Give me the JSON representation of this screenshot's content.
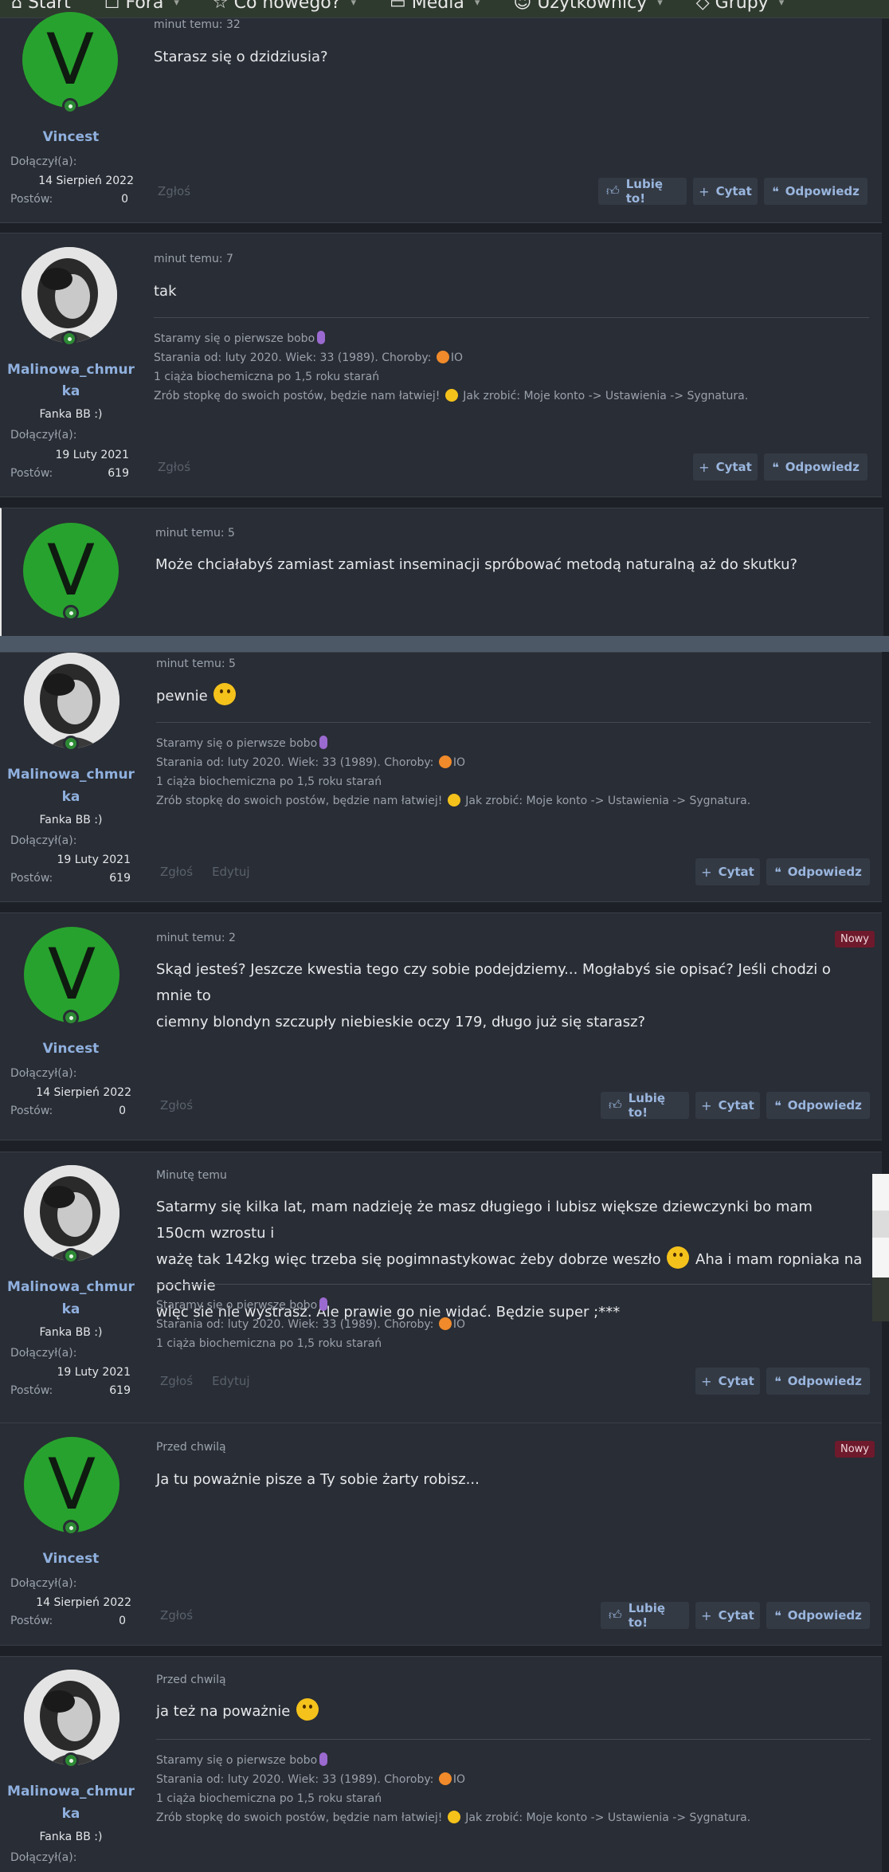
{
  "nav": {
    "items": [
      {
        "label": "Start",
        "icon": "home-icon"
      },
      {
        "label": "Fora",
        "icon": "chat-icon"
      },
      {
        "label": "Co nowego?",
        "icon": "bookmark-icon"
      },
      {
        "label": "Media",
        "icon": "media-icon"
      },
      {
        "label": "Użytkownicy",
        "icon": "user-icon"
      },
      {
        "label": "Grupy",
        "icon": "diamond-icon"
      }
    ]
  },
  "labels": {
    "joined": "Dołączył(a):",
    "posts": "Postów:",
    "report": "Zgłoś",
    "edit": "Edytuj",
    "like": "Lubię to!",
    "quote": "Cytat",
    "reply": "Odpowiedz",
    "new": "Nowy"
  },
  "users": {
    "vincest": {
      "name": "Vincest",
      "initial": "V",
      "joined": "14 Sierpień 2022",
      "posts": "0"
    },
    "malinowa": {
      "name_line1": "Malinowa_chmur",
      "name_line2": "ka",
      "title": "Fanka BB :)",
      "joined": "19 Luty 2021",
      "posts": "619"
    }
  },
  "signature": {
    "line1": "Staramy się o pierwsze bobo",
    "line2a": "Starania od: luty 2020. Wiek: 33 (1989). Choroby:",
    "line2b": "IO",
    "line3": "1 ciąża biochemiczna po 1,5 roku starań",
    "line4a": "Zrób stopkę do swoich postów, będzie nam łatwiej!",
    "line4b": "Jak zrobić: Moje konto -> Ustawienia -> Sygnatura."
  },
  "posts": [
    {
      "time": "minut temu: 32",
      "text": "Starasz się o dzidziusia?"
    },
    {
      "time": "minut temu: 7",
      "text": "tak"
    },
    {
      "time": "minut temu: 5",
      "text": "Może chciałabyś zamiast zamiast inseminacji spróbować metodą naturalną aż do skutku?"
    },
    {
      "time": "minut temu: 5",
      "text": "pewnie"
    },
    {
      "time": "minut temu: 2",
      "text_line1": "Skąd jesteś? Jeszcze kwestia tego czy sobie podejdziemy... Mogłabyś sie opisać? Jeśli chodzi o mnie to",
      "text_line2": "ciemny blondyn szczupły niebieskie oczy 179, długo już się starasz?"
    },
    {
      "time": "Minutę temu",
      "text_line1": "Satarmy się kilka lat, mam nadzieję że masz długiego i lubisz większe dziewczynki bo mam 150cm wzrostu i",
      "text_line2a": "ważę tak 142kg więc trzeba się pogimnastykowac żeby dobrze weszło",
      "text_line2b": "Aha i mam ropniaka na pochwie",
      "text_line3": "więc sie nie wystrasz. Ale prawie go nie widać. Będzie super ;***"
    },
    {
      "time": "Przed chwilą",
      "text": "Ja tu poważnie pisze a Ty sobie żarty robisz..."
    },
    {
      "time": "Przed chwilą",
      "text": "ja też na poważnie"
    }
  ]
}
